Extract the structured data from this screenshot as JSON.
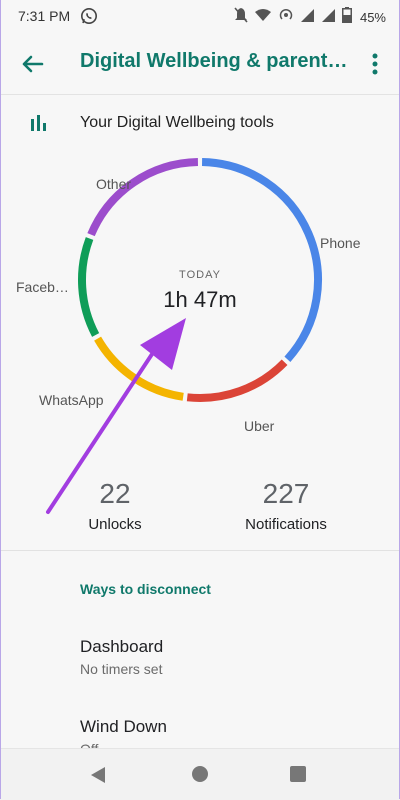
{
  "status_bar": {
    "time": "7:31 PM",
    "left_icons": [
      "whatsapp-icon"
    ],
    "right_icons": [
      "mute-icon",
      "wifi-icon",
      "hotspot-icon",
      "signal-icon",
      "signal-icon",
      "battery-icon"
    ],
    "battery": "45%"
  },
  "app_bar": {
    "title": "Digital Wellbeing & parental controls",
    "back_icon": "arrow-back-icon",
    "menu_icon": "more-vert-icon",
    "accent_color": "#10796b"
  },
  "tools_header": {
    "label": "Your Digital Wellbeing tools",
    "icon": "bar-chart-icon"
  },
  "usage": {
    "center_caption": "TODAY",
    "center_value": "1h 47m",
    "slices": [
      {
        "label": "Phone",
        "color": "#4a86e8",
        "share": 0.37
      },
      {
        "label": "Uber",
        "color": "#db4437",
        "share": 0.15
      },
      {
        "label": "WhatsApp",
        "color": "#f4b400",
        "share": 0.15
      },
      {
        "label": "Faceb…",
        "color": "#0f9d58",
        "share": 0.14
      },
      {
        "label": "Other",
        "color": "#9c4dcc",
        "share": 0.19
      }
    ]
  },
  "stats": {
    "unlocks_value": "22",
    "unlocks_label": "Unlocks",
    "notifications_value": "227",
    "notifications_label": "Notifications"
  },
  "section": {
    "title": "Ways to disconnect"
  },
  "list": [
    {
      "title": "Dashboard",
      "subtitle": "No timers set"
    },
    {
      "title": "Wind Down",
      "subtitle": "Off"
    }
  ],
  "nav_bar": {
    "back_icon": "nav-back-icon",
    "home_icon": "nav-home-icon",
    "recents_icon": "nav-recents-icon"
  },
  "annotation": {
    "arrow_color": "#a23de0"
  }
}
